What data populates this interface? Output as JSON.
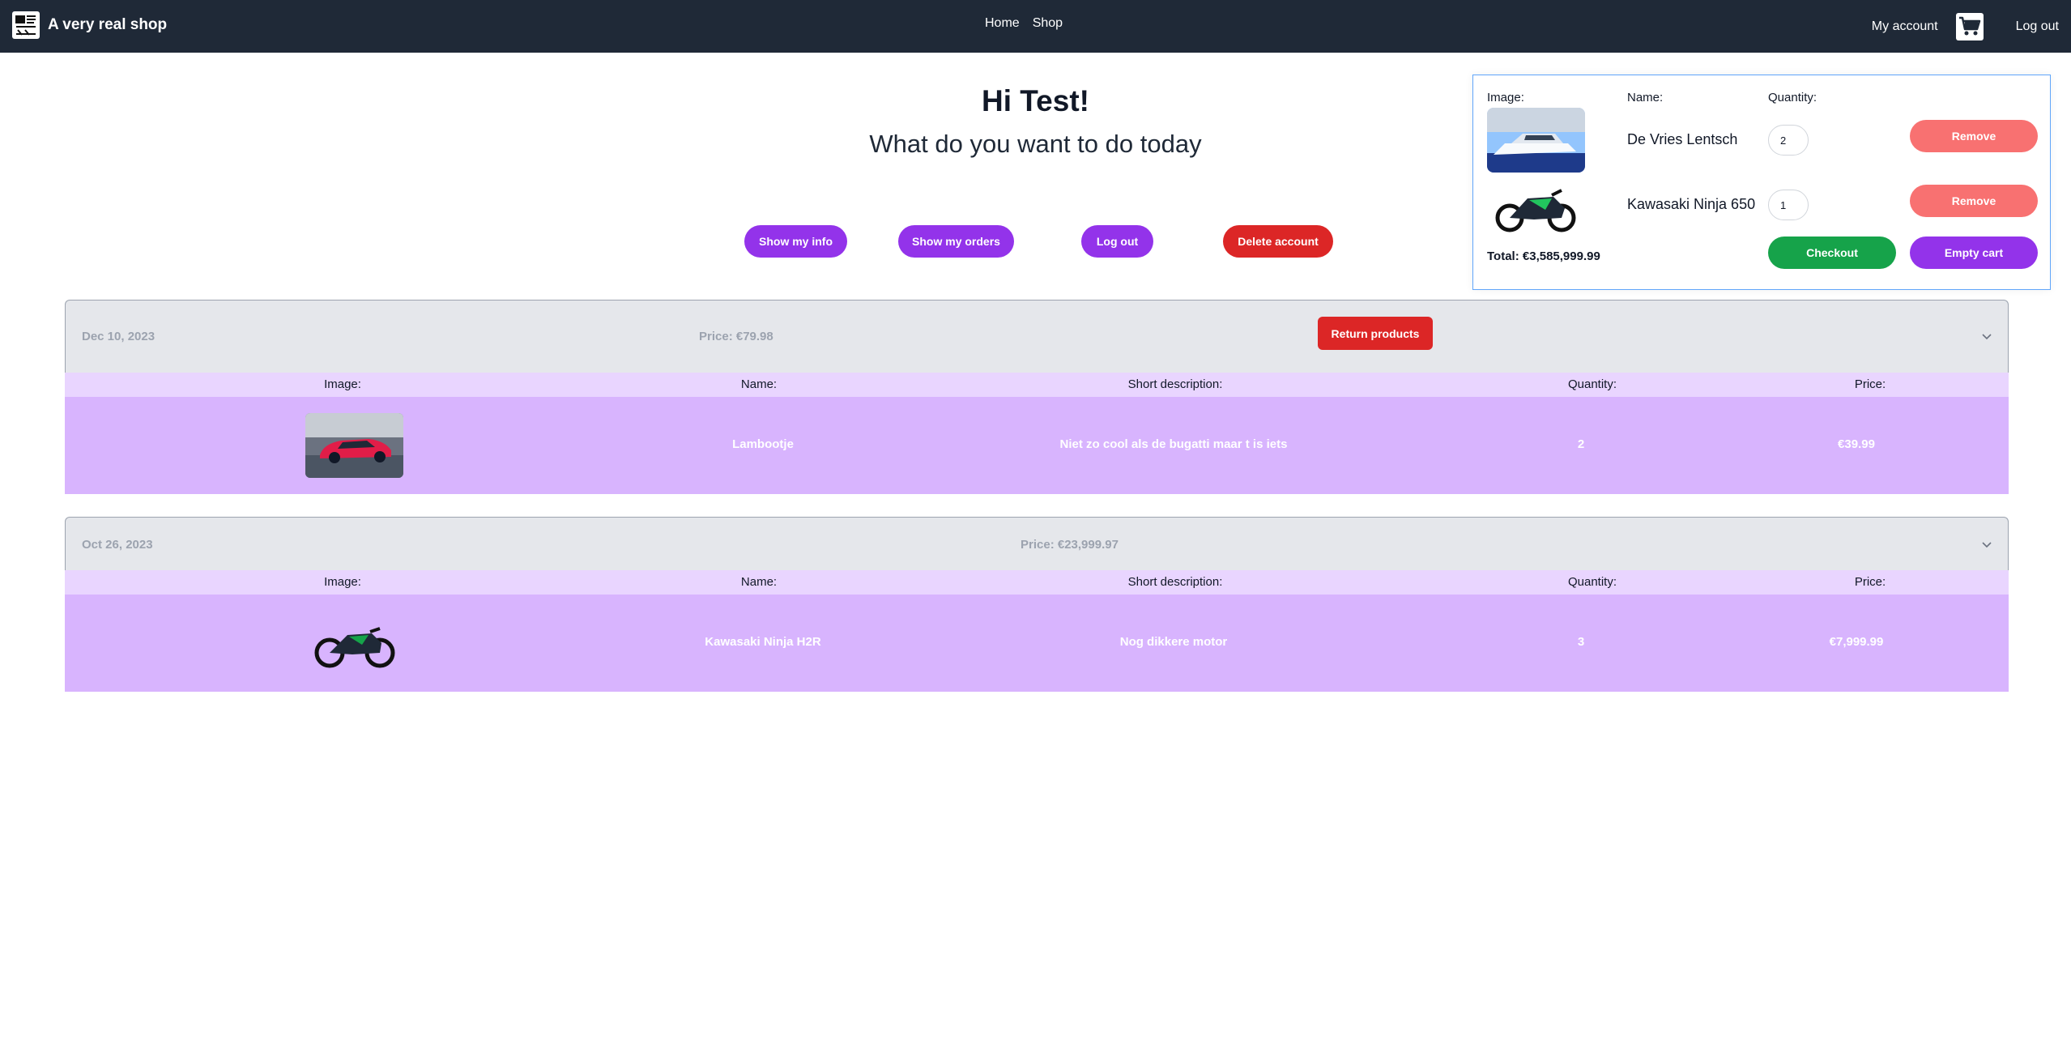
{
  "navbar": {
    "brand_title": "A very real shop",
    "logo_icon": "shop-logo-icon",
    "links": {
      "home": "Home",
      "shop": "Shop"
    },
    "my_account": "My account",
    "cart_icon": "shopping-cart-icon",
    "logout": "Log out",
    "background": "#1f2937"
  },
  "greeting": {
    "title": "Hi Test!",
    "subtitle": "What do you want to do today"
  },
  "actions": {
    "show_info": "Show my info",
    "show_orders": "Show my orders",
    "log_out": "Log out",
    "delete_account": "Delete account"
  },
  "cart": {
    "headers": {
      "image": "Image:",
      "name": "Name:",
      "quantity": "Quantity:"
    },
    "items": [
      {
        "name": "De Vries Lentsch",
        "quantity": "2",
        "remove_label": "Remove",
        "image": "yacht-image"
      },
      {
        "name": "Kawasaki Ninja 650",
        "quantity": "1",
        "remove_label": "Remove",
        "image": "motorcycle-image"
      }
    ],
    "total": "Total: €3,585,999.99",
    "checkout_label": "Checkout",
    "empty_label": "Empty cart"
  },
  "orders": [
    {
      "date": "Dec 10, 2023",
      "price": "Price: €79.98",
      "return_label": "Return products",
      "columns": {
        "image": "Image:",
        "name": "Name:",
        "short_description": "Short description:",
        "quantity": "Quantity:",
        "price": "Price:"
      },
      "items": [
        {
          "image": "red-sports-car-image",
          "name": "Lambootje",
          "short_description": "Niet zo cool als de bugatti maar t is iets",
          "quantity": "2",
          "price": "€39.99"
        }
      ]
    },
    {
      "date": "Oct 26, 2023",
      "price": "Price: €23,999.97",
      "columns": {
        "image": "Image:",
        "name": "Name:",
        "short_description": "Short description:",
        "quantity": "Quantity:",
        "price": "Price:"
      },
      "items": [
        {
          "image": "motorcycle-image",
          "name": "Kawasaki Ninja H2R",
          "short_description": "Nog dikkere motor",
          "quantity": "3",
          "price": "€7,999.99"
        }
      ]
    }
  ],
  "colors": {
    "purple": "#9333ea",
    "red": "#dc2626",
    "green": "#16a34a",
    "light_red": "#f87171",
    "row_purple": "#d8b4fe",
    "header_purple": "#e9d5ff"
  }
}
